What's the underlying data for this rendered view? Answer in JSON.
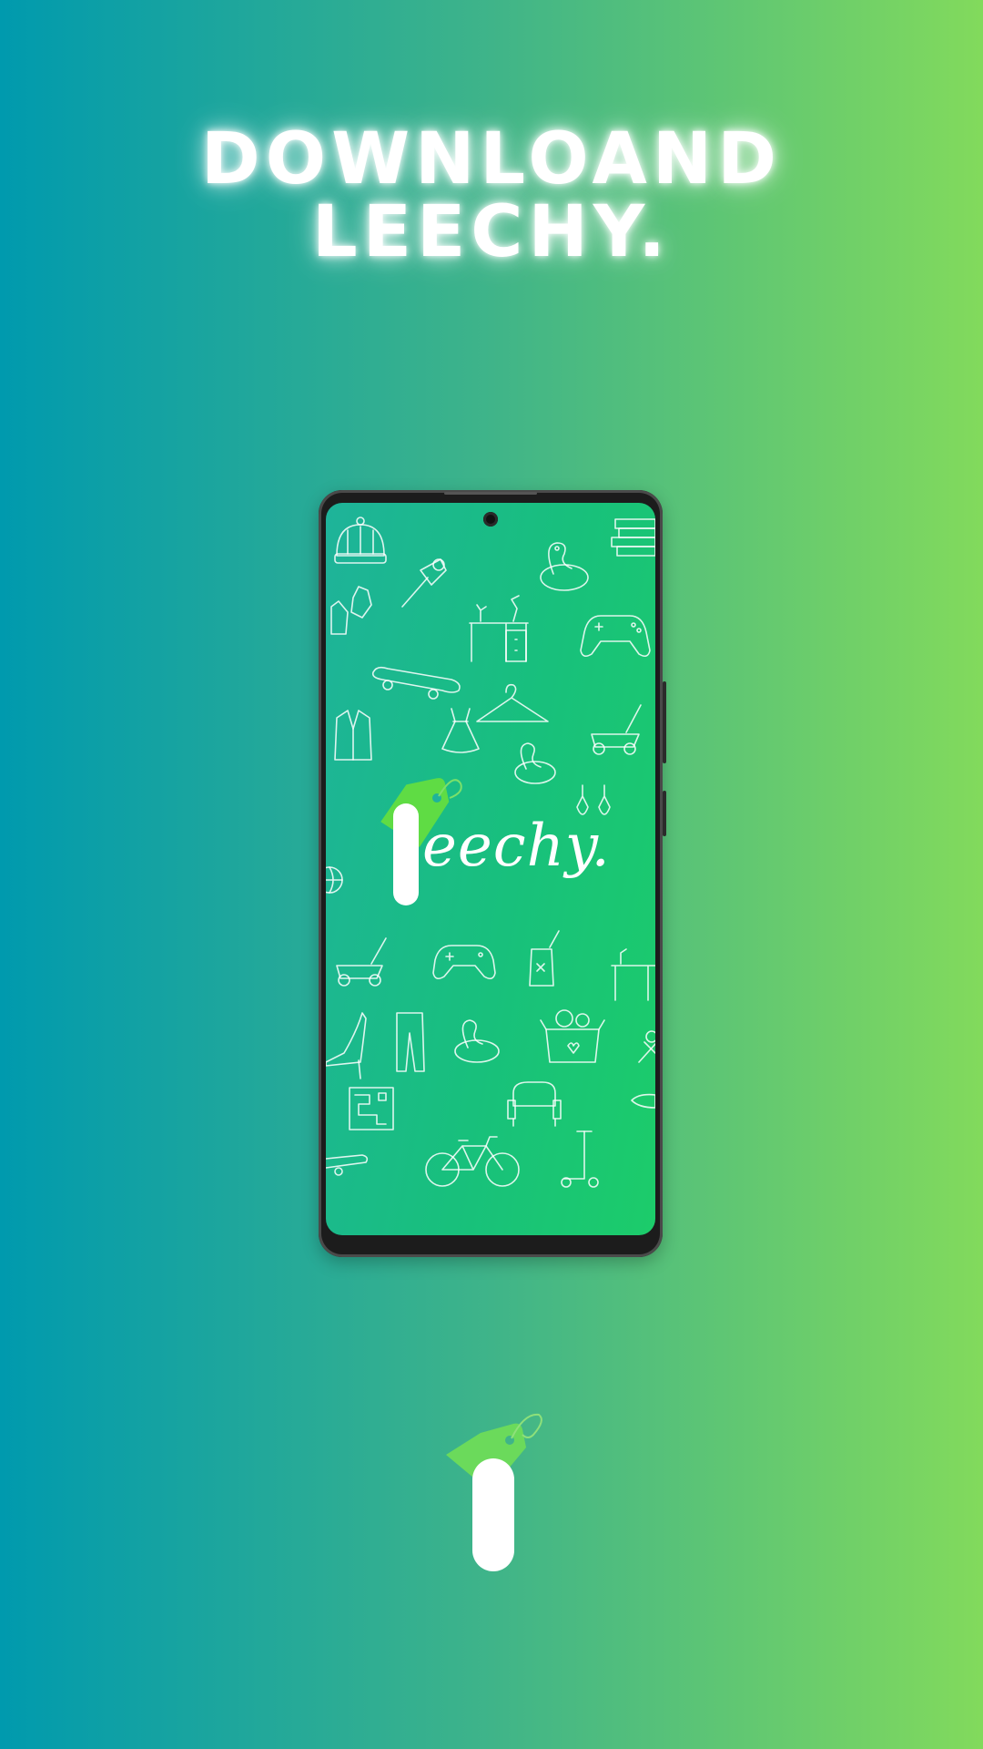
{
  "headline": {
    "line1": "DOWNLOAND",
    "line2": "LEECHY."
  },
  "app": {
    "logo_text": "eechy."
  },
  "colors": {
    "bg_left": "#009aae",
    "bg_right": "#82da5c",
    "screen_green": "#18c07c",
    "tag_green": "#5fdc44",
    "white": "#ffffff"
  },
  "icons": [
    "beanie-icon",
    "leaf-blower-icon",
    "flamingo-float-icon",
    "books-icon",
    "gloves-icon",
    "desk-icon",
    "gamepad-icon",
    "skateboard-icon",
    "dress-icon",
    "hanger-icon",
    "jacket-icon",
    "lawn-mower-icon",
    "earrings-icon",
    "basketball-icon",
    "jar-icon",
    "heels-icon",
    "jeans-icon",
    "toy-box-icon",
    "tools-icon",
    "armchair-icon",
    "board-game-icon",
    "bicycle-icon",
    "scooter-icon",
    "price-tag-icon"
  ]
}
